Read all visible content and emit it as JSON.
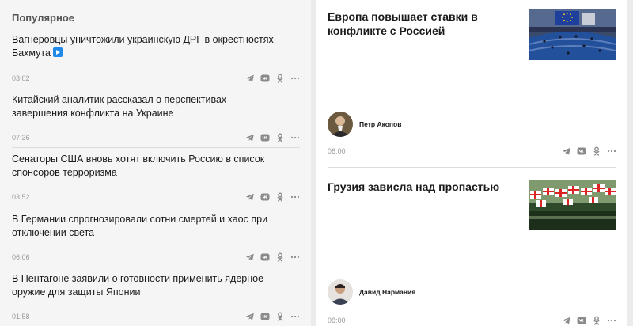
{
  "popular": {
    "title": "Популярное",
    "items": [
      {
        "title": "Вагнеровцы уничтожили украинскую ДРГ в окрестностях Бахмута",
        "time": "03:02",
        "has_video": true
      },
      {
        "title": "Китайский аналитик рассказал о перспективах завершения конфликта на Украине",
        "time": "07:36"
      },
      {
        "title": "Сенаторы США вновь хотят включить Россию в список спонсоров терроризма",
        "time": "03:52"
      },
      {
        "title": "В Германии спрогнозировали сотни смертей и хаос при отключении света",
        "time": "06:06"
      },
      {
        "title": "В Пентагоне заявили о готовности применить ядерное оружие для защиты Японии",
        "time": "01:58"
      }
    ]
  },
  "articles": [
    {
      "title": "Европа повышает ставки в конфликте с Россией",
      "author": "Петр Акопов",
      "time": "08:00",
      "image": "european-parliament-photo"
    },
    {
      "title": "Грузия зависла над пропастью",
      "author": "Давид Нармания",
      "time": "08:00",
      "image": "georgian-flags-photo"
    }
  ],
  "share_icons": [
    "telegram-icon",
    "vk-icon",
    "odnoklassniki-icon",
    "more-icon"
  ],
  "colors": {
    "accent_blue": "#1f8ae8",
    "meta_gray": "#999999",
    "icon_gray": "#8a8a8a"
  }
}
